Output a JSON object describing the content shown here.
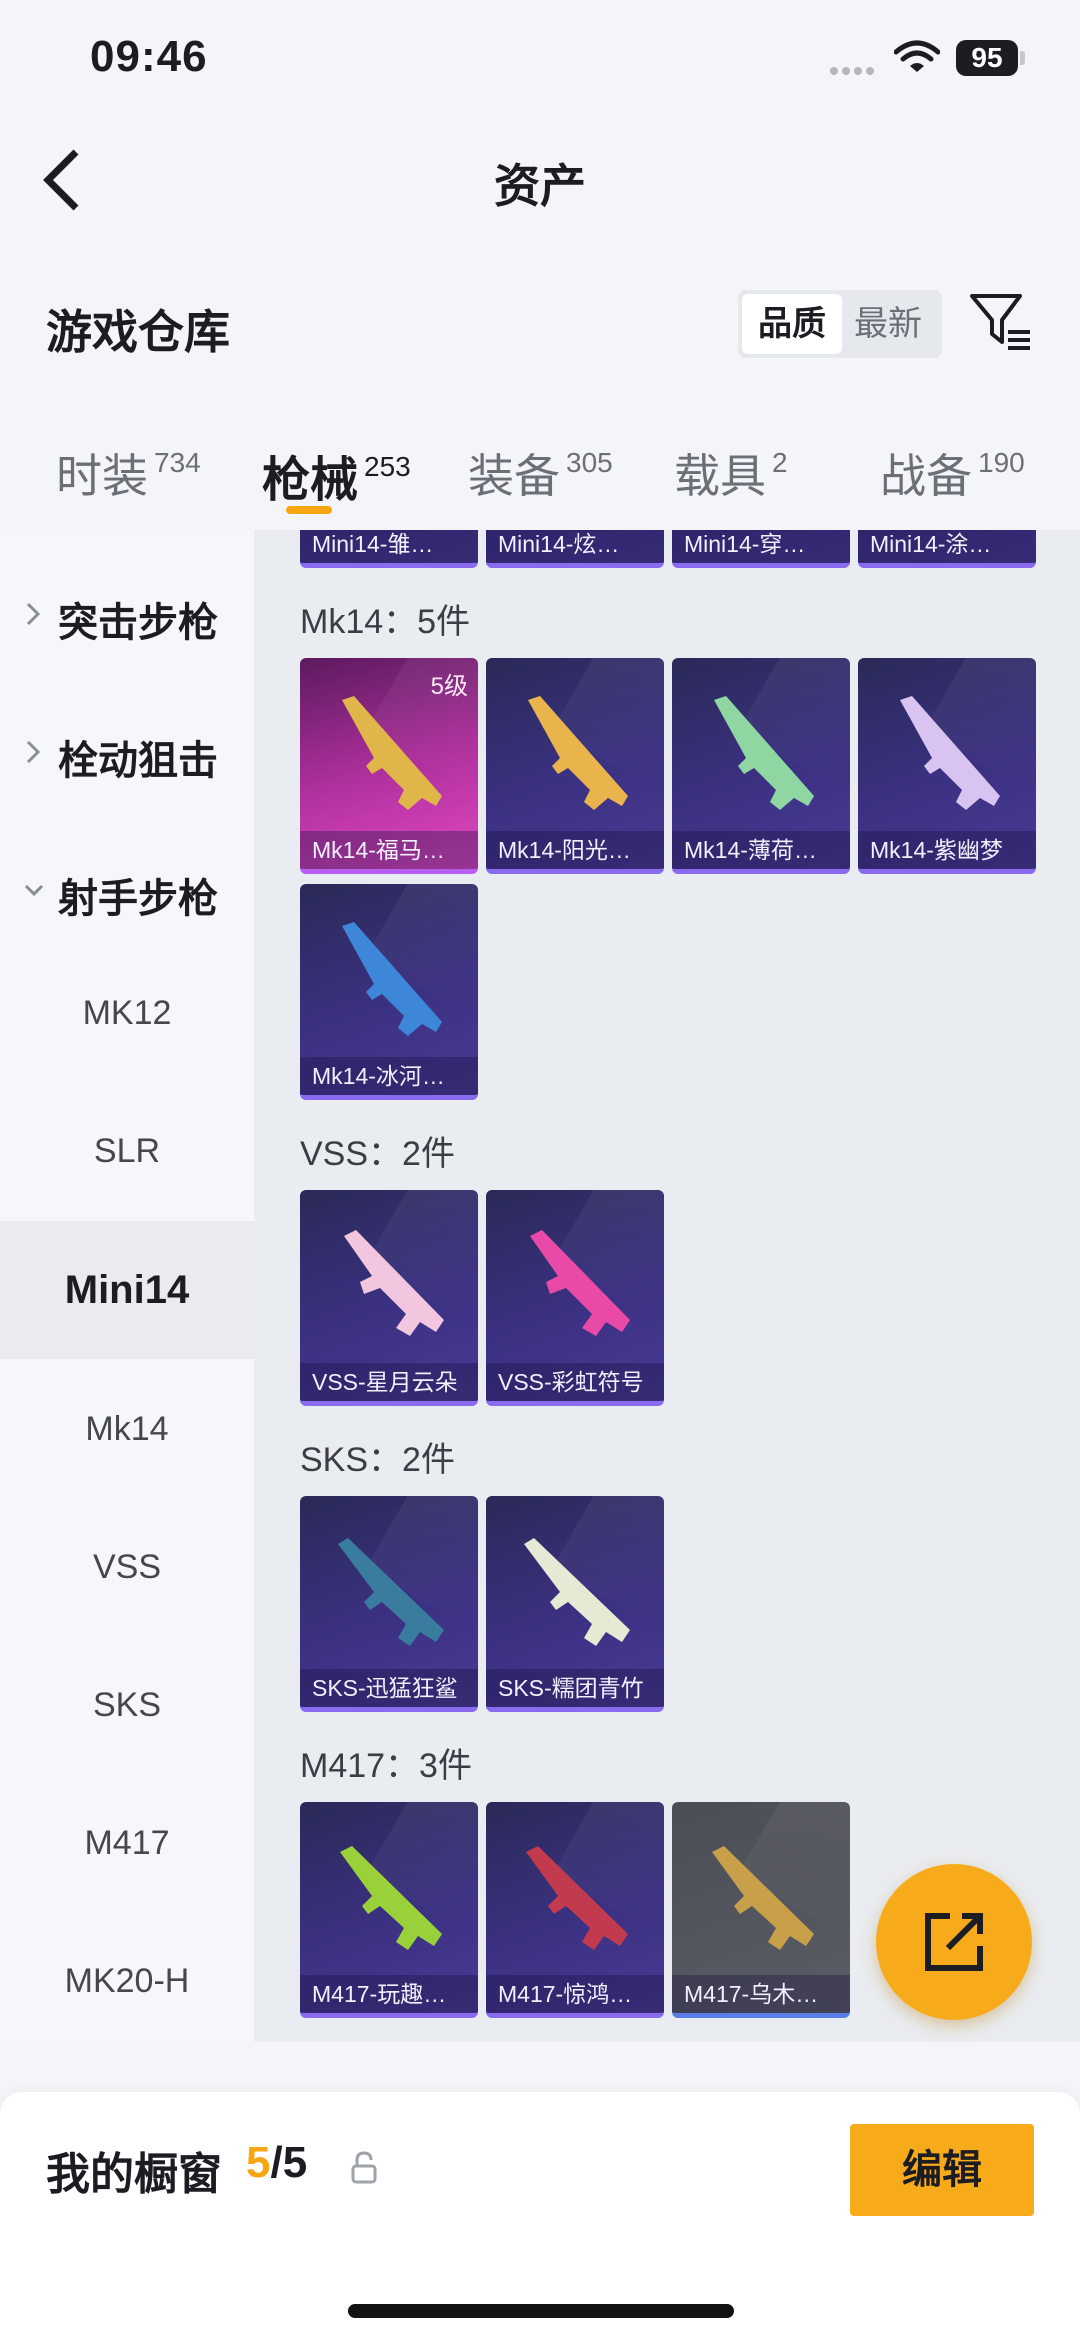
{
  "status": {
    "time": "09:46",
    "battery": "95"
  },
  "nav": {
    "title": "资产"
  },
  "warehouse": {
    "title": "游戏仓库",
    "sort_options": [
      "品质",
      "最新"
    ],
    "sort_selected": "品质"
  },
  "tabs": [
    {
      "label": "时装",
      "count": "734"
    },
    {
      "label": "枪械",
      "count": "253",
      "active": true
    },
    {
      "label": "装备",
      "count": "305"
    },
    {
      "label": "载具",
      "count": "2"
    },
    {
      "label": "战备",
      "count": "190"
    }
  ],
  "sidebar": {
    "groups": [
      {
        "label": "突击步枪",
        "expanded": false
      },
      {
        "label": "栓动狙击",
        "expanded": false
      },
      {
        "label": "射手步枪",
        "expanded": true
      }
    ],
    "items": [
      "MK12",
      "SLR",
      "Mini14",
      "Mk14",
      "VSS",
      "SKS",
      "M417",
      "MK20-H"
    ],
    "active_item": "Mini14"
  },
  "sections": {
    "mini14": {
      "items": [
        "Mini14-雏…",
        "Mini14-炫…",
        "Mini14-穿…",
        "Mini14-涂…"
      ]
    },
    "mk14": {
      "title": "Mk14：5件",
      "items": [
        {
          "name": "Mk14-福马…",
          "level": "5级",
          "rarity": "legendary",
          "color": "#e0b54a"
        },
        {
          "name": "Mk14-阳光…",
          "rarity": "epic",
          "color": "#e9b44c"
        },
        {
          "name": "Mk14-薄荷…",
          "rarity": "epic",
          "color": "#8fd6a2"
        },
        {
          "name": "Mk14-紫幽梦",
          "rarity": "epic",
          "color": "#d9c3f1"
        },
        {
          "name": "Mk14-冰河…",
          "rarity": "epic",
          "color": "#3d86d8"
        }
      ]
    },
    "vss": {
      "title": "VSS：2件",
      "items": [
        {
          "name": "VSS-星月云朵",
          "rarity": "epic",
          "color": "#f1c6de"
        },
        {
          "name": "VSS-彩虹符号",
          "rarity": "epic",
          "color": "#e94aa8"
        }
      ]
    },
    "sks": {
      "title": "SKS：2件",
      "items": [
        {
          "name": "SKS-迅猛狂鲨",
          "rarity": "epic",
          "color": "#3a7c9e"
        },
        {
          "name": "SKS-糯团青竹",
          "rarity": "epic",
          "color": "#e6ead4"
        }
      ]
    },
    "m417": {
      "title": "M417：3件",
      "items": [
        {
          "name": "M417-玩趣…",
          "rarity": "epic",
          "color": "#9ad13a"
        },
        {
          "name": "M417-惊鸿…",
          "rarity": "epic",
          "color": "#c23a4e"
        },
        {
          "name": "M417-乌木…",
          "rarity": "common",
          "color": "#c9a04a"
        }
      ]
    }
  },
  "showcase": {
    "label": "我的橱窗",
    "current": "5",
    "total": "/5"
  },
  "edit_label": "编辑",
  "colors": {
    "accent": "#f8ab1a",
    "highlight_text": "#f6a613"
  }
}
